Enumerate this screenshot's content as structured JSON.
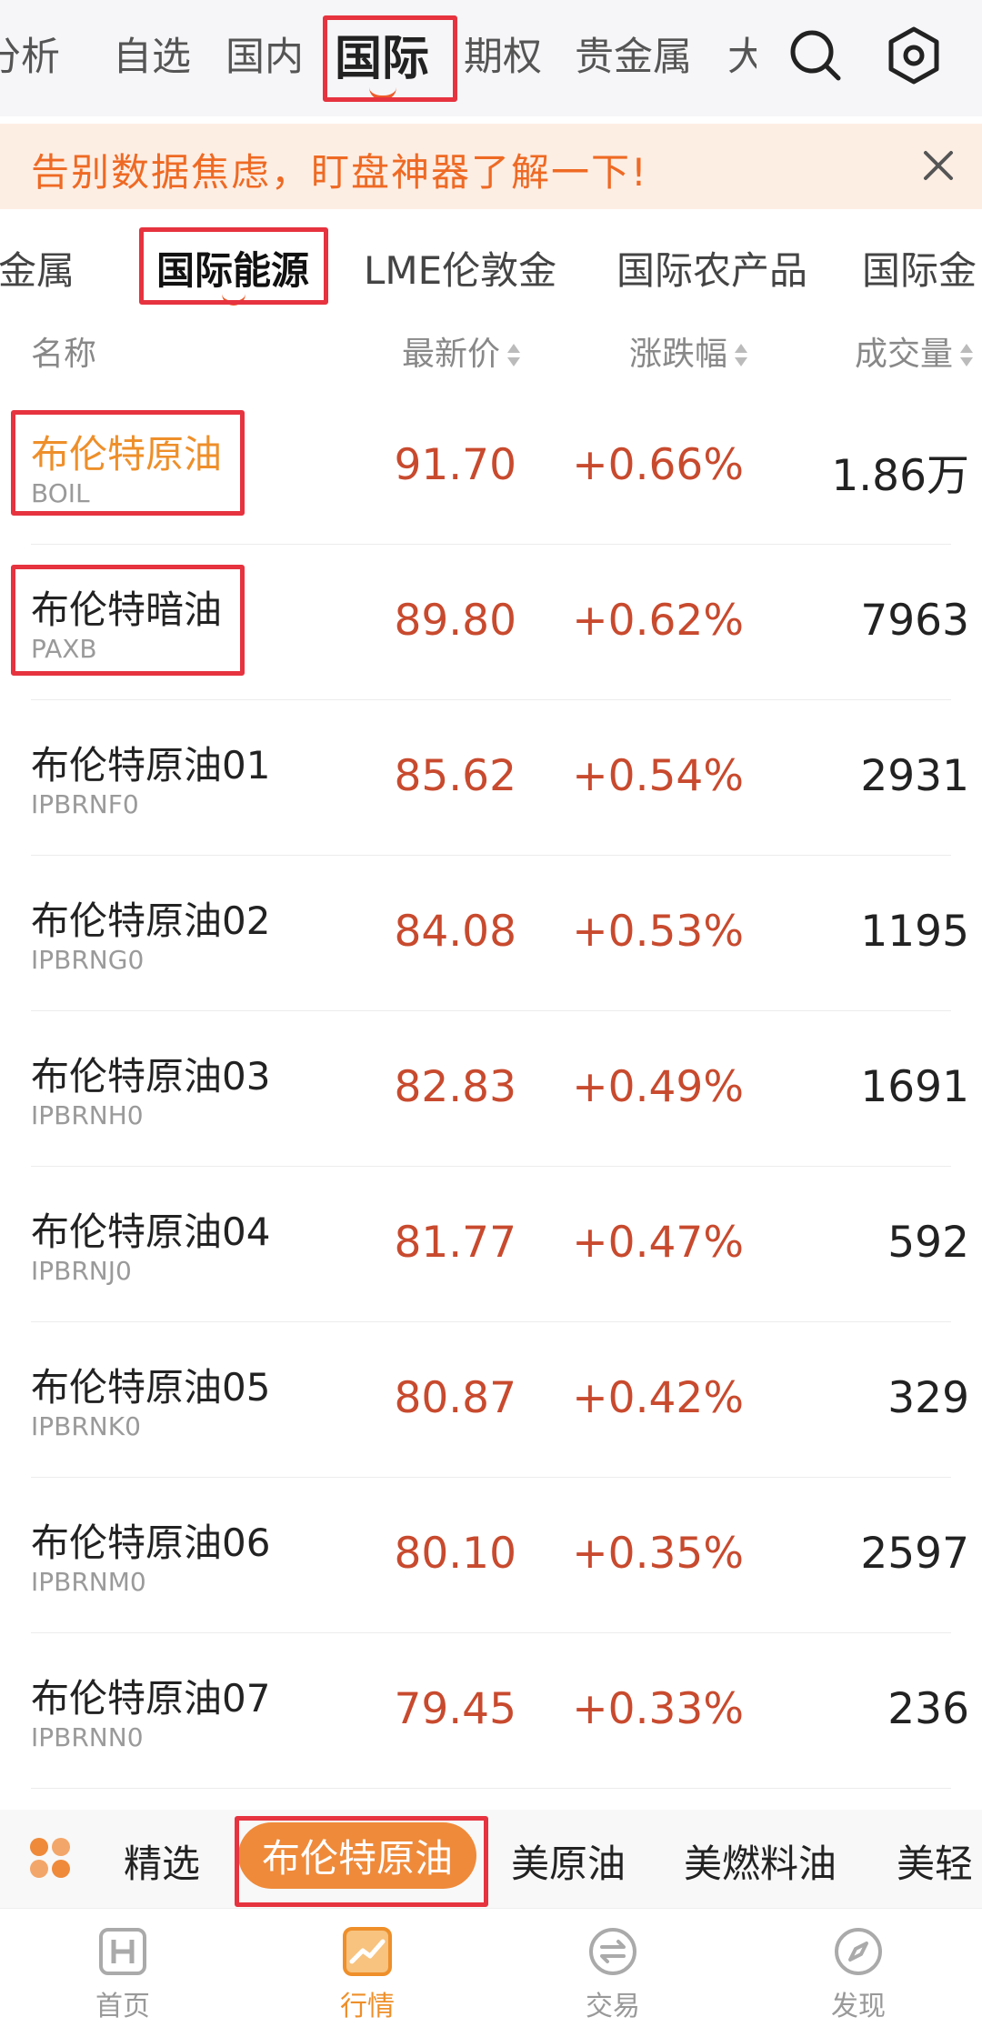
{
  "top_tabs": [
    {
      "label": "分析"
    },
    {
      "label": "自选"
    },
    {
      "label": "国内"
    },
    {
      "label": "国际",
      "active": true
    },
    {
      "label": "期权"
    },
    {
      "label": "贵金属"
    },
    {
      "label": "大"
    }
  ],
  "top_icons": [
    "search-icon",
    "settings-icon"
  ],
  "banner": {
    "text": "告别数据焦虑，盯盘神器了解一下!"
  },
  "sub_tabs": [
    {
      "label": "贵金属"
    },
    {
      "label": "国际能源",
      "active": true
    },
    {
      "label": "LME伦敦金"
    },
    {
      "label": "国际农产品"
    },
    {
      "label": "国际金"
    }
  ],
  "table": {
    "headers": {
      "name": "名称",
      "price": "最新价",
      "change": "涨跌幅",
      "volume": "成交量"
    },
    "rows": [
      {
        "name": "布伦特原油",
        "code": "BOIL",
        "price": "91.70",
        "change": "+0.66%",
        "volume": "1.86万",
        "highlight": true
      },
      {
        "name": "布伦特暗油",
        "code": "PAXB",
        "price": "89.80",
        "change": "+0.62%",
        "volume": "7963"
      },
      {
        "name": "布伦特原油01",
        "code": "IPBRNF0",
        "price": "85.62",
        "change": "+0.54%",
        "volume": "2931"
      },
      {
        "name": "布伦特原油02",
        "code": "IPBRNG0",
        "price": "84.08",
        "change": "+0.53%",
        "volume": "1195"
      },
      {
        "name": "布伦特原油03",
        "code": "IPBRNH0",
        "price": "82.83",
        "change": "+0.49%",
        "volume": "1691"
      },
      {
        "name": "布伦特原油04",
        "code": "IPBRNJ0",
        "price": "81.77",
        "change": "+0.47%",
        "volume": "592"
      },
      {
        "name": "布伦特原油05",
        "code": "IPBRNK0",
        "price": "80.87",
        "change": "+0.42%",
        "volume": "329"
      },
      {
        "name": "布伦特原油06",
        "code": "IPBRNM0",
        "price": "80.10",
        "change": "+0.35%",
        "volume": "2597"
      },
      {
        "name": "布伦特原油07",
        "code": "IPBRNN0",
        "price": "79.45",
        "change": "+0.33%",
        "volume": "236"
      }
    ]
  },
  "category_bar": [
    {
      "label": "精选"
    },
    {
      "label": "布伦特原油",
      "active": true
    },
    {
      "label": "美原油"
    },
    {
      "label": "美燃料油"
    },
    {
      "label": "美轻"
    }
  ],
  "bottom_nav": [
    {
      "label": "首页",
      "icon": "home-icon"
    },
    {
      "label": "行情",
      "icon": "market-icon",
      "active": true
    },
    {
      "label": "交易",
      "icon": "trade-icon"
    },
    {
      "label": "发现",
      "icon": "discover-icon"
    }
  ],
  "colors": {
    "accent": "#ef8a3a",
    "up": "#c84a2e",
    "annotation": "#e6333f"
  }
}
